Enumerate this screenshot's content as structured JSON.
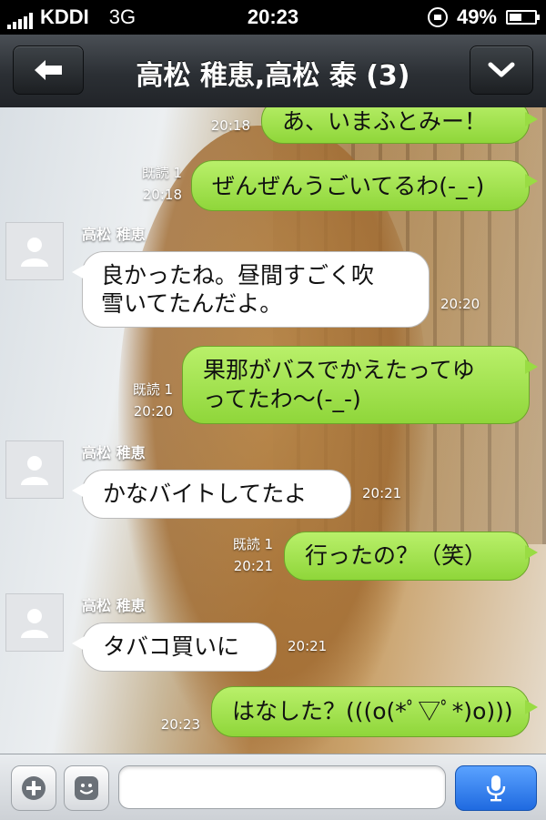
{
  "status_bar": {
    "carrier": "KDDI",
    "network": "3G",
    "time": "20:23",
    "battery": "49%",
    "battery_level": 0.49
  },
  "header": {
    "title": "高松 稚恵,高松 泰 (3)",
    "back_icon": "back-arrow-icon",
    "menu_icon": "chevron-down-icon"
  },
  "messages": [
    {
      "side": "me",
      "text": "あ、いまふとみー！",
      "time": "20:18",
      "read": ""
    },
    {
      "side": "me",
      "text": "ぜんぜんうごいてるわ(-_-)",
      "time": "20:18",
      "read": "既読 1"
    },
    {
      "side": "you",
      "sender": "高松 稚恵",
      "lines": [
        "良かったね。昼間すごく吹",
        "雪いてたんだよ。"
      ],
      "time": "20:20"
    },
    {
      "side": "me",
      "lines": [
        "果那がバスでかえたってゆ",
        "ってたわ〜(-_-)"
      ],
      "time": "20:20",
      "read": "既読 1"
    },
    {
      "side": "you",
      "sender": "高松 稚恵",
      "text": "かなバイトしてたよ",
      "time": "20:21"
    },
    {
      "side": "me",
      "text": "行ったの？（笑）",
      "time": "20:21",
      "read": "既読 1"
    },
    {
      "side": "you",
      "sender": "高松 稚恵",
      "text": "タバコ買いに",
      "time": "20:21"
    },
    {
      "side": "me",
      "text": "はなした？(((o(*ﾟ▽ﾟ*)o)))",
      "time": "20:23",
      "read": ""
    }
  ],
  "input_bar": {
    "placeholder": "",
    "plus_icon": "plus-icon",
    "emoji_icon": "emoji-icon",
    "mic_icon": "microphone-icon"
  },
  "colors": {
    "my_bubble": "#9ad845",
    "their_bubble": "#ffffff",
    "mic_button": "#2f7cf0"
  }
}
